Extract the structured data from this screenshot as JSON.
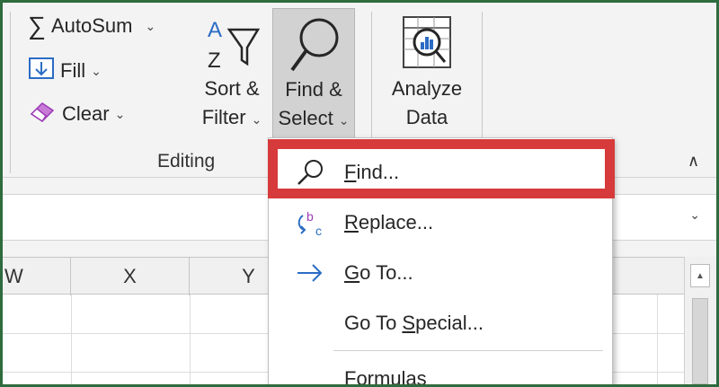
{
  "ribbon": {
    "autosum": {
      "icon": "sigma-icon",
      "label": "AutoSum",
      "chevron": "⌄"
    },
    "fill": {
      "icon": "fill-down-icon",
      "label": "Fill",
      "chevron": "⌄"
    },
    "clear": {
      "icon": "eraser-icon",
      "label": "Clear",
      "chevron": "⌄"
    },
    "sort_filter": {
      "icon": "sort-filter-icon",
      "line1": "Sort &",
      "line2": "Filter",
      "chevron": "⌄"
    },
    "find_select": {
      "icon": "magnifier-icon",
      "line1": "Find &",
      "line2": "Select",
      "chevron": "⌄",
      "state": "pressed"
    },
    "analyze_data": {
      "icon": "analyze-data-icon",
      "line1": "Analyze",
      "line2": "Data"
    },
    "group_label": "Editing",
    "collapse_glyph": "∧"
  },
  "formula_bar": {
    "expand_glyph": "⌄"
  },
  "grid": {
    "columns": [
      "W",
      "X",
      "Y"
    ]
  },
  "menu": {
    "items": [
      {
        "icon": "find-icon",
        "underline": "F",
        "rest": "ind...",
        "highlighted": true
      },
      {
        "icon": "replace-icon",
        "underline": "R",
        "rest": "eplace..."
      },
      {
        "icon": "goto-arrow-icon",
        "underline": "G",
        "rest": "o To..."
      },
      {
        "icon": "",
        "prefix": "Go To ",
        "underline": "S",
        "rest": "pecial..."
      },
      {
        "icon": "",
        "underline": "",
        "rest": "Formulas"
      }
    ],
    "highlight_color": "#d63a3a"
  },
  "colors": {
    "ribbon_bg": "#f3f3f3",
    "pressed_bg": "#d2d2d2",
    "accent_blue": "#2b6cc4",
    "replace_purple": "#9b3bb7",
    "frame_green": "#2e6b3e"
  }
}
